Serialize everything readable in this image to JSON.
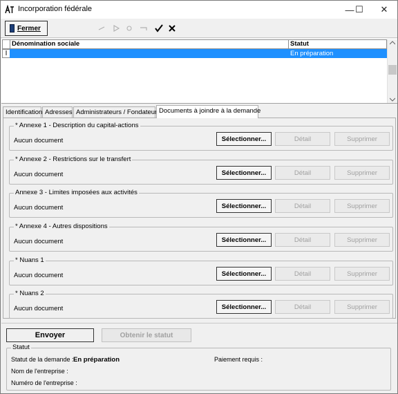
{
  "window": {
    "title": "Incorporation fédérale",
    "controls": {
      "minimize": "—",
      "maximize": "☐",
      "close": "✕"
    }
  },
  "toolbar": {
    "close_label": "Fermer",
    "icons": [
      "first-icon",
      "prev-icon",
      "next-icon",
      "last-icon",
      "checkmark-icon",
      "cross-icon"
    ]
  },
  "grid": {
    "columns": [
      "Dénomination sociale",
      "Statut"
    ],
    "rows": [
      {
        "name": "",
        "status": "En préparation"
      }
    ]
  },
  "tabs": [
    "Identification",
    "Adresses",
    "Administrateurs / Fondateurs",
    "Documents à joindre à la demande"
  ],
  "documents": [
    {
      "label": "* Annexe 1 - Description du capital-actions",
      "status": "Aucun document"
    },
    {
      "label": "* Annexe 2 - Restrictions sur le transfert",
      "status": "Aucun document"
    },
    {
      "label": "Annexe 3 - Limites imposées aux activités",
      "status": "Aucun document"
    },
    {
      "label": "* Annexe 4 - Autres dispositions",
      "status": "Aucun document"
    },
    {
      "label": "* Nuans 1",
      "status": "Aucun document"
    },
    {
      "label": "* Nuans 2",
      "status": "Aucun document"
    }
  ],
  "doc_buttons": {
    "select": "Sélectionner...",
    "detail": "Détail",
    "delete": "Supprimer"
  },
  "actions": {
    "send": "Envoyer",
    "get_status": "Obtenir le statut"
  },
  "status_group": {
    "legend": "Statut",
    "request_status_label": "Statut de la demande :",
    "request_status_value": "En préparation",
    "payment_label": "Paiement requis :",
    "company_name_label": "Nom de l'entreprise :",
    "company_number_label": "Numéro de l'entreprise :"
  }
}
